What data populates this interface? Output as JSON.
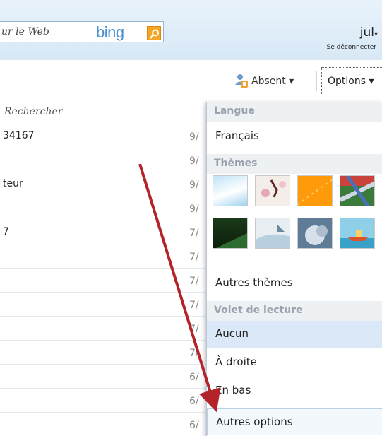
{
  "header": {
    "search_placeholder": "ur le Web",
    "bing_label": "bing",
    "user_name": "jul",
    "logout_label": "Se déconnecter"
  },
  "toolbar": {
    "absent_label": "Absent ▾",
    "options_label": "Options ▾"
  },
  "list": {
    "search_placeholder": "Rechercher",
    "rows": [
      {
        "text": "34167",
        "date": "9/"
      },
      {
        "text": "",
        "date": "9/"
      },
      {
        "text": "teur",
        "date": "9/"
      },
      {
        "text": "",
        "date": "9/"
      },
      {
        "text": "7",
        "date": "7/"
      },
      {
        "text": "",
        "date": "7/"
      },
      {
        "text": "",
        "date": "7/"
      },
      {
        "text": "",
        "date": "7/"
      },
      {
        "text": "",
        "date": "7/"
      },
      {
        "text": "",
        "date": "7/"
      },
      {
        "text": "",
        "date": "6/"
      },
      {
        "text": "",
        "date": "6/"
      },
      {
        "text": "",
        "date": "6/"
      }
    ]
  },
  "menu": {
    "language_header": "Langue",
    "language_value": "Français",
    "themes_header": "Thèmes",
    "themes": [
      "sky-theme",
      "flower-theme",
      "orange-theme",
      "map-theme",
      "green-theme",
      "sky-fold-theme",
      "cloud-theme",
      "boat-theme"
    ],
    "more_themes": "Autres thèmes",
    "reading_header": "Volet de lecture",
    "reading_none": "Aucun",
    "reading_right": "À droite",
    "reading_bottom": "En bas",
    "more_options": "Autres options"
  },
  "colors": {
    "accent": "#4a8fd0",
    "arrow": "#b3242a",
    "selected": "#dbe8f7"
  }
}
